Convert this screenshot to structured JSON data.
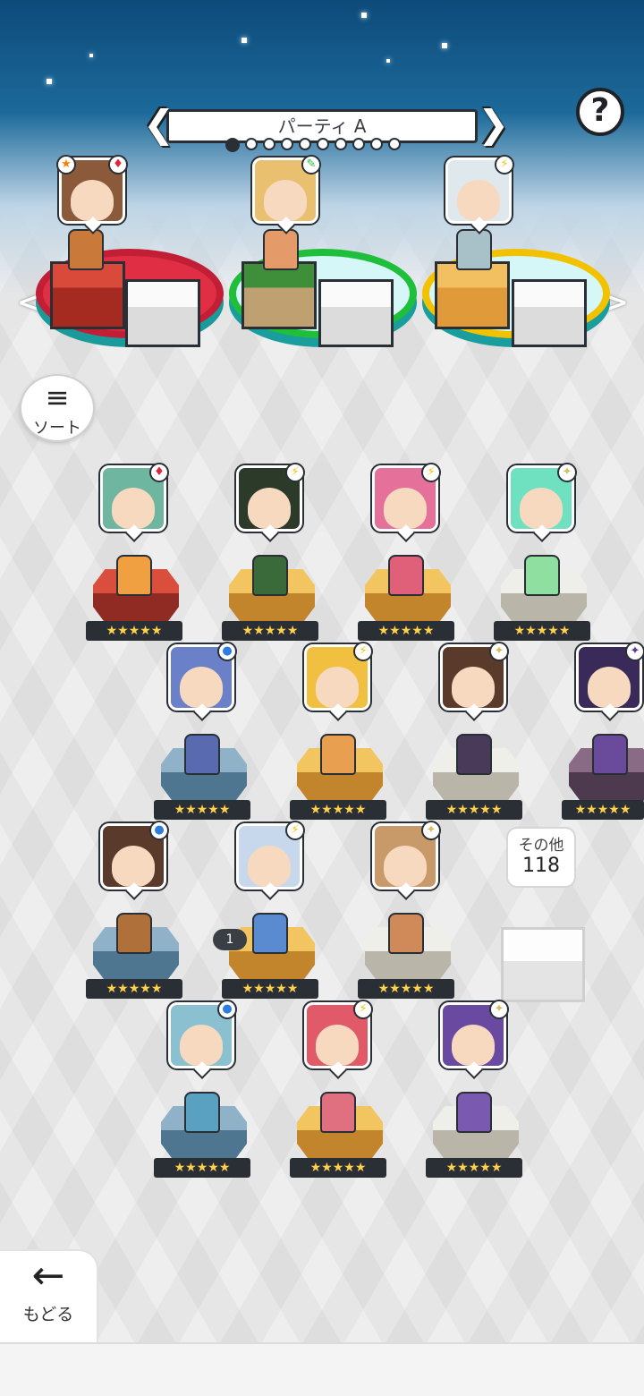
{
  "header": {
    "party_name": "パーティ A",
    "prev_arrow": "❮",
    "next_arrow": "❯",
    "page_indicator": {
      "count": 10,
      "active_index": 0
    },
    "help_glyph": "?"
  },
  "party_slots": [
    {
      "badge_left": "★",
      "badge_right": "♦"
    },
    {
      "badge_right": "✎"
    },
    {
      "badge_right": "⚡"
    }
  ],
  "side_arrows": {
    "left": "<",
    "right": ">"
  },
  "sort": {
    "icon": "sort-icon",
    "label": "ソート"
  },
  "roster": {
    "star_text": "★★★★★",
    "other": {
      "label": "その他",
      "value": "118"
    },
    "message_badge": "1"
  },
  "footer": {
    "back_label": "もどる",
    "back_icon": "←"
  },
  "colors": {
    "sky_top": "#0d4a7a",
    "fire": "#e02e44",
    "wind": "#1fbf3c",
    "thunder": "#f2c200"
  }
}
